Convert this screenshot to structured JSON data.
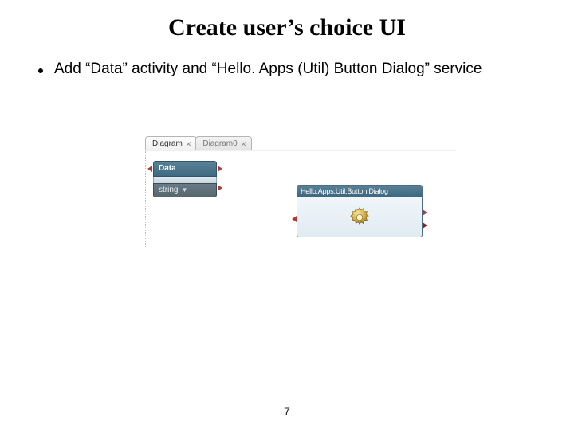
{
  "title": "Create user’s choice UI",
  "bullet": "Add “Data” activity and “Hello. Apps (Util) Button Dialog” service",
  "tabs": {
    "active": {
      "label": "Diagram"
    },
    "inactive": {
      "label": "Diagram0"
    }
  },
  "data_node": {
    "title": "Data",
    "type_label": "string"
  },
  "service_node": {
    "title": "Hello.Apps.Util.Button.Dialog",
    "icon": "gear-icon"
  },
  "page_number": "7"
}
